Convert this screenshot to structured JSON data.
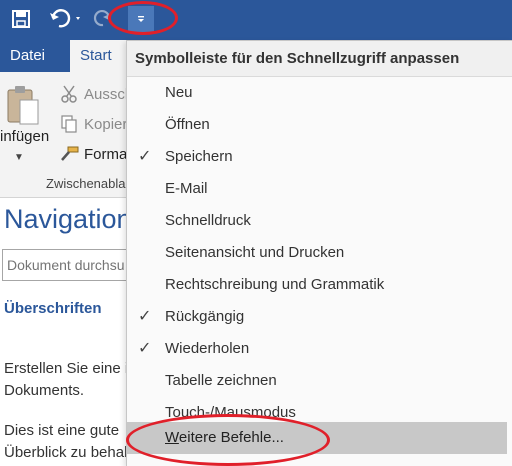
{
  "quick_access": {
    "save_icon": "save-icon",
    "undo_icon": "undo-icon",
    "redo_icon": "redo-icon",
    "customize_icon": "customize-dropdown-icon"
  },
  "tabs": {
    "datei": "Datei",
    "start": "Start"
  },
  "ribbon": {
    "paste_label": "infügen",
    "cut_label": "Aussch",
    "copy_label": "Kopier",
    "format_label": "Forma",
    "group_label": "Zwischenabla"
  },
  "nav": {
    "title": "Navigation",
    "search_placeholder": "Dokument durchsu",
    "headings_tab": "Überschriften",
    "text_line1": "Erstellen Sie eine i",
    "text_line2": "Dokuments.",
    "text_line3": "Dies ist eine gute",
    "text_line4": "Überblick zu behal"
  },
  "menu": {
    "header": "Symbolleiste für den Schnellzugriff anpassen",
    "items": [
      {
        "label": "Neu",
        "checked": false
      },
      {
        "label": "Öffnen",
        "checked": false
      },
      {
        "label": "Speichern",
        "checked": true
      },
      {
        "label": "E-Mail",
        "checked": false
      },
      {
        "label": "Schnelldruck",
        "checked": false
      },
      {
        "label": "Seitenansicht und Drucken",
        "checked": false
      },
      {
        "label": "Rechtschreibung und Grammatik",
        "checked": false
      },
      {
        "label": "Rückgängig",
        "checked": true
      },
      {
        "label": "Wiederholen",
        "checked": true
      },
      {
        "label": "Tabelle zeichnen",
        "checked": false
      },
      {
        "label": "Touch-/Mausmodus",
        "checked": false
      }
    ],
    "more_mnemonic": "W",
    "more_rest": "eitere Befehle..."
  },
  "colors": {
    "word_blue": "#2b579a",
    "annotation_red": "#e0202a",
    "highlight_gray": "#c8c8c8"
  }
}
